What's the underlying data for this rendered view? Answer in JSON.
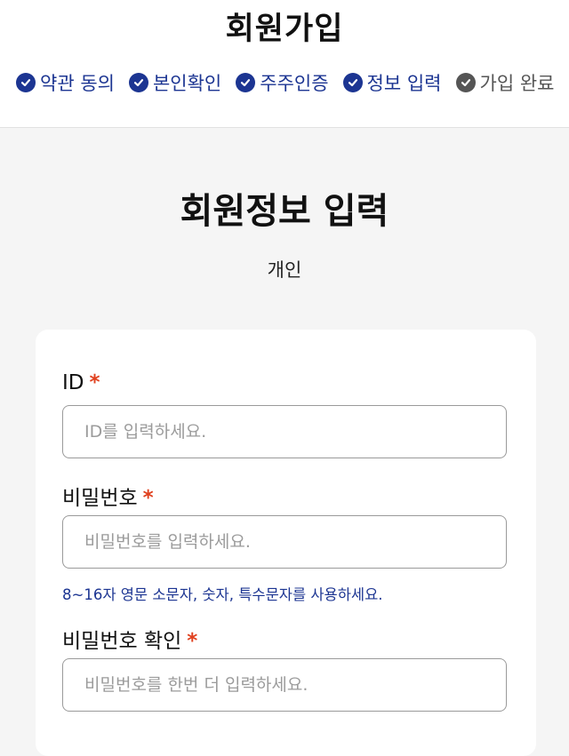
{
  "header": {
    "title": "회원가입",
    "steps": [
      {
        "label": "약관 동의",
        "done": true
      },
      {
        "label": "본인확인",
        "done": true
      },
      {
        "label": "주주인증",
        "done": true
      },
      {
        "label": "정보 입력",
        "done": true
      },
      {
        "label": "가입 완료",
        "done": false
      }
    ]
  },
  "main": {
    "title": "회원정보 입력",
    "subtitle": "개인"
  },
  "form": {
    "required_mark": "*",
    "id": {
      "label": "ID",
      "placeholder": "ID를 입력하세요."
    },
    "password": {
      "label": "비밀번호",
      "placeholder": "비밀번호를 입력하세요.",
      "hint": "8~16자 영문 소문자, 숫자, 특수문자를 사용하세요."
    },
    "password_confirm": {
      "label": "비밀번호 확인",
      "placeholder": "비밀번호를 한번 더 입력하세요."
    }
  },
  "colors": {
    "accent": "#1c3592",
    "required": "#e0411f",
    "inactive_step": "#555555",
    "page_background": "#f5f5f5"
  },
  "icons": {
    "step_done": "check-circle-icon",
    "step_pending": "check-circle-icon"
  }
}
